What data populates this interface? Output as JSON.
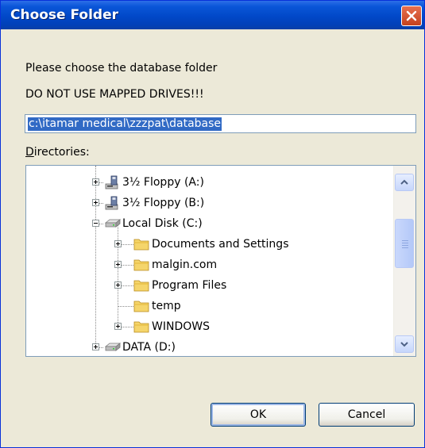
{
  "dialog": {
    "title": "Choose Folder",
    "message1": "Please choose the database folder",
    "message2": "DO NOT USE MAPPED DRIVES!!!",
    "path_value": "c:\\itamar medical\\zzzpat\\database",
    "directories_label_hotkey": "D",
    "directories_label_rest": "irectories:",
    "ok_label": "OK",
    "cancel_label": "Cancel"
  },
  "tree": {
    "items": [
      {
        "label": "3½ Floppy (A:)",
        "icon": "floppy-drive-icon",
        "expander": "plus"
      },
      {
        "label": "3½ Floppy (B:)",
        "icon": "floppy-drive-icon",
        "expander": "plus"
      },
      {
        "label": "Local Disk (C:)",
        "icon": "hard-drive-icon",
        "expander": "minus"
      },
      {
        "label": "Documents and Settings",
        "icon": "folder-icon",
        "expander": "plus"
      },
      {
        "label": "malgin.com",
        "icon": "folder-icon",
        "expander": "plus"
      },
      {
        "label": "Program Files",
        "icon": "folder-icon",
        "expander": "plus"
      },
      {
        "label": "temp",
        "icon": "folder-icon",
        "expander": "none"
      },
      {
        "label": "WINDOWS",
        "icon": "folder-icon",
        "expander": "plus"
      },
      {
        "label": "DATA (D:)",
        "icon": "hard-drive-icon",
        "expander": "plus"
      }
    ]
  },
  "colors": {
    "titlebar": "#0148C8",
    "selection": "#316AC5",
    "dialog_bg": "#ECE9D8"
  }
}
